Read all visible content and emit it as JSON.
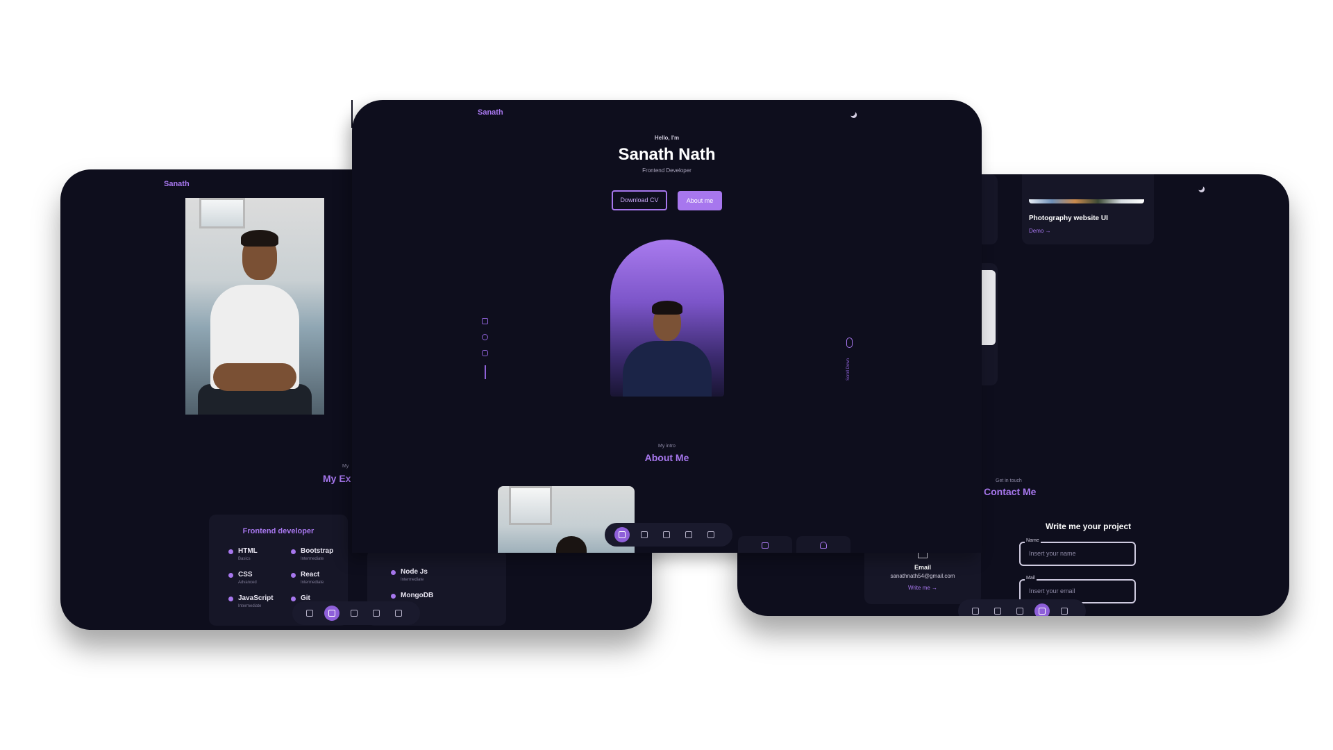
{
  "left": {
    "brand": "Sanath",
    "section_sub": "My",
    "section_title": "My Ex",
    "card_title": "Frontend developer",
    "skills_a": [
      {
        "name": "HTML",
        "level": "Basics"
      },
      {
        "name": "Bootstrap",
        "level": "Intermediate"
      },
      {
        "name": "CSS",
        "level": "Advanced"
      },
      {
        "name": "React",
        "level": "Intermediate"
      },
      {
        "name": "JavaScript",
        "level": "Intermediate"
      },
      {
        "name": "Git",
        "level": ""
      }
    ],
    "skills_b": [
      {
        "name": "Node Js",
        "level": "Intermediate"
      },
      {
        "name": "MongoDB",
        "level": ""
      }
    ],
    "nav": [
      "home-icon",
      "user-icon",
      "briefcase-icon",
      "image-icon",
      "message-icon"
    ],
    "nav_active": 1
  },
  "center": {
    "brand": "Sanath",
    "greeting": "Hello, I'm",
    "name": "Sanath Nath",
    "role": "Frontend Developer",
    "btn_download": "Download CV",
    "btn_about": "About me",
    "social": [
      "linkedin-icon",
      "github-icon",
      "instagram-icon"
    ],
    "scroll_label": "Scroll Down",
    "intro_sub": "My intro",
    "intro_title": "About Me",
    "nav": [
      "home-icon",
      "user-icon",
      "briefcase-icon",
      "image-icon",
      "message-icon"
    ],
    "nav_active": 0
  },
  "right": {
    "project_name": "Photography website UI",
    "project_demo": "Demo →",
    "contact_sub": "Get in touch",
    "contact_title": "Contact Me",
    "write_title": "Write me your project",
    "name_label": "Name",
    "name_placeholder": "Insert your name",
    "mail_label": "Mail",
    "mail_placeholder": "Insert your email",
    "email_label": "Email",
    "email_value": "sanathnath54@gmail.com",
    "email_link": "Write me →",
    "nav": [
      "home-icon",
      "user-icon",
      "briefcase-icon",
      "image-icon",
      "message-icon"
    ],
    "nav_active": 3
  },
  "colors": {
    "background": "#0e0e1d",
    "accent": "#a777ee",
    "card": "#161627"
  }
}
